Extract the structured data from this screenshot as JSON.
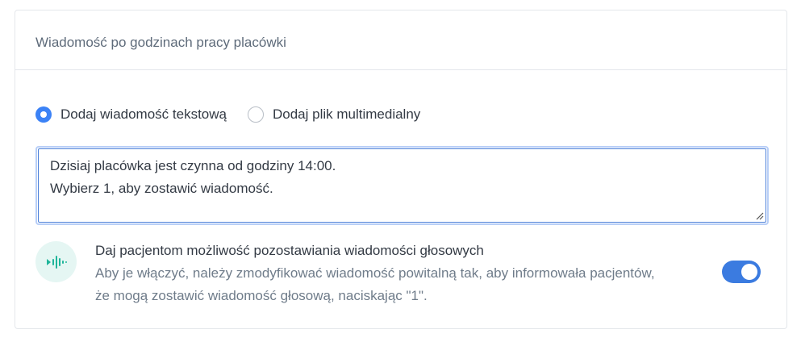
{
  "card": {
    "title": "Wiadomość po godzinach pracy placówki"
  },
  "message_type": {
    "options": [
      {
        "label": "Dodaj wiadomość tekstową",
        "checked": true
      },
      {
        "label": "Dodaj plik multimedialny",
        "checked": false
      }
    ]
  },
  "message": {
    "lines": [
      "Dzisiaj placówka jest czynna od godziny 14:00.",
      "Wybierz 1, aby zostawić wiadomość."
    ]
  },
  "voice_messages": {
    "icon": "audio-waveform-icon",
    "title": "Daj pacjentom możliwość pozostawiania wiadomości głosowych",
    "description": "Aby je włączyć, należy zmodyfikować wiadomość powitalną tak, aby informowała pacjentów, że mogą zostawić wiadomość głosową, naciskając \"1\".",
    "enabled": true
  },
  "colors": {
    "accent": "#3b82f6",
    "icon_bg": "#e5f6f3",
    "icon_fg": "#1fb59a"
  }
}
